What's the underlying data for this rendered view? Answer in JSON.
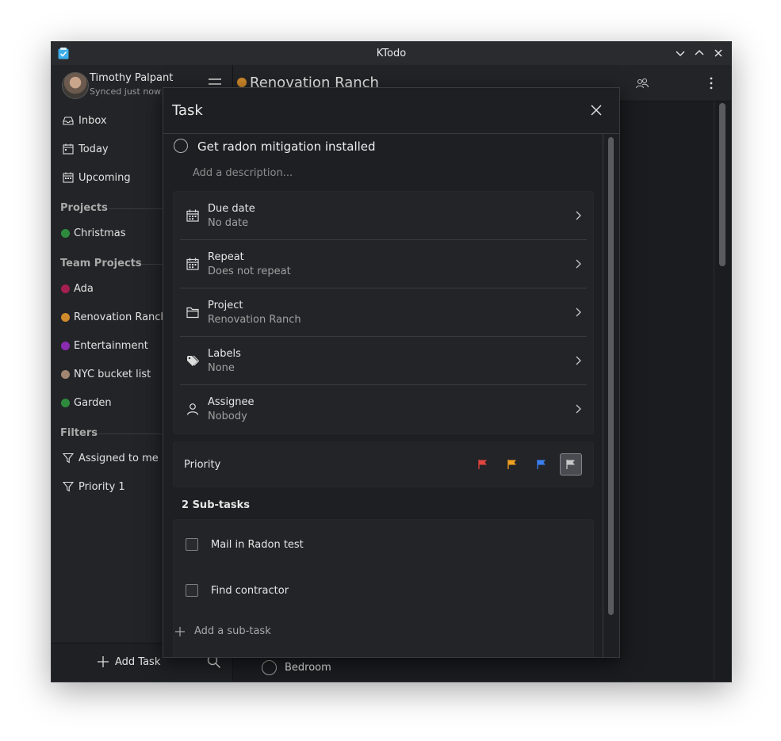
{
  "window": {
    "title": "KTodo"
  },
  "user": {
    "name": "Timothy Palpant",
    "sync_status": "Synced just now"
  },
  "nav": {
    "inbox": "Inbox",
    "today": "Today",
    "upcoming": "Upcoming"
  },
  "projects": {
    "heading": "Projects",
    "items": [
      {
        "label": "Christmas",
        "color": "#2e8b3e"
      }
    ]
  },
  "team_projects": {
    "heading": "Team Projects",
    "items": [
      {
        "label": "Ada",
        "color": "#a3204f"
      },
      {
        "label": "Renovation Ranch",
        "color": "#d08a2b"
      },
      {
        "label": "Entertainment",
        "color": "#8a2bb0"
      },
      {
        "label": "NYC bucket list",
        "color": "#a08670"
      },
      {
        "label": "Garden",
        "color": "#2e8b3e"
      }
    ]
  },
  "filters": {
    "heading": "Filters",
    "items": [
      {
        "label": "Assigned to me"
      },
      {
        "label": "Priority 1"
      }
    ]
  },
  "sidebar_bottom": {
    "add_task": "Add Task"
  },
  "main": {
    "project_title": "Renovation Ranch",
    "project_color": "#d08a2b",
    "visible_task": "Bedroom"
  },
  "dialog": {
    "title": "Task",
    "task_title": "Get radon mitigation installed",
    "description_placeholder": "Add a description...",
    "properties": [
      {
        "label": "Due date",
        "value": "No date",
        "icon": "calendar-icon"
      },
      {
        "label": "Repeat",
        "value": "Does not repeat",
        "icon": "calendar-icon"
      },
      {
        "label": "Project",
        "value": "Renovation Ranch",
        "icon": "folder-icon"
      },
      {
        "label": "Labels",
        "value": "None",
        "icon": "tag-icon"
      },
      {
        "label": "Assignee",
        "value": "Nobody",
        "icon": "person-icon"
      }
    ],
    "priority": {
      "label": "Priority",
      "flags": [
        {
          "color": "#e0443e"
        },
        {
          "color": "#f0a020"
        },
        {
          "color": "#3a7ef0"
        },
        {
          "color": "#c8c8c8"
        }
      ]
    },
    "subtasks": {
      "heading": "2 Sub-tasks",
      "items": [
        {
          "label": "Mail in Radon test"
        },
        {
          "label": "Find contractor"
        }
      ],
      "add_label": "Add a sub-task"
    }
  }
}
